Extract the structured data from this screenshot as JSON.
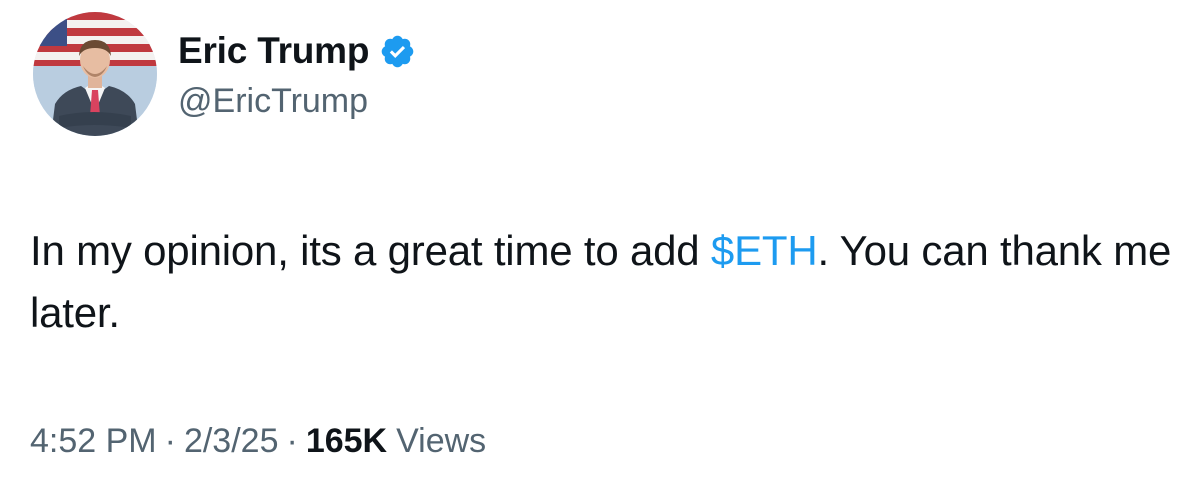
{
  "author": {
    "display_name": "Eric Trump",
    "handle": "@EricTrump",
    "verified": true,
    "verified_color": "#1d9bf0",
    "avatar_icon": "profile-photo"
  },
  "tweet": {
    "text_before": "In my opinion, its a great time to add ",
    "cashtag": "$ETH",
    "text_after": ". You can thank me later.",
    "cashtag_color": "#1d9bf0"
  },
  "meta": {
    "time": "4:52 PM",
    "separator": "·",
    "date": "2/3/25",
    "views_count": "165K",
    "views_label": "Views"
  }
}
